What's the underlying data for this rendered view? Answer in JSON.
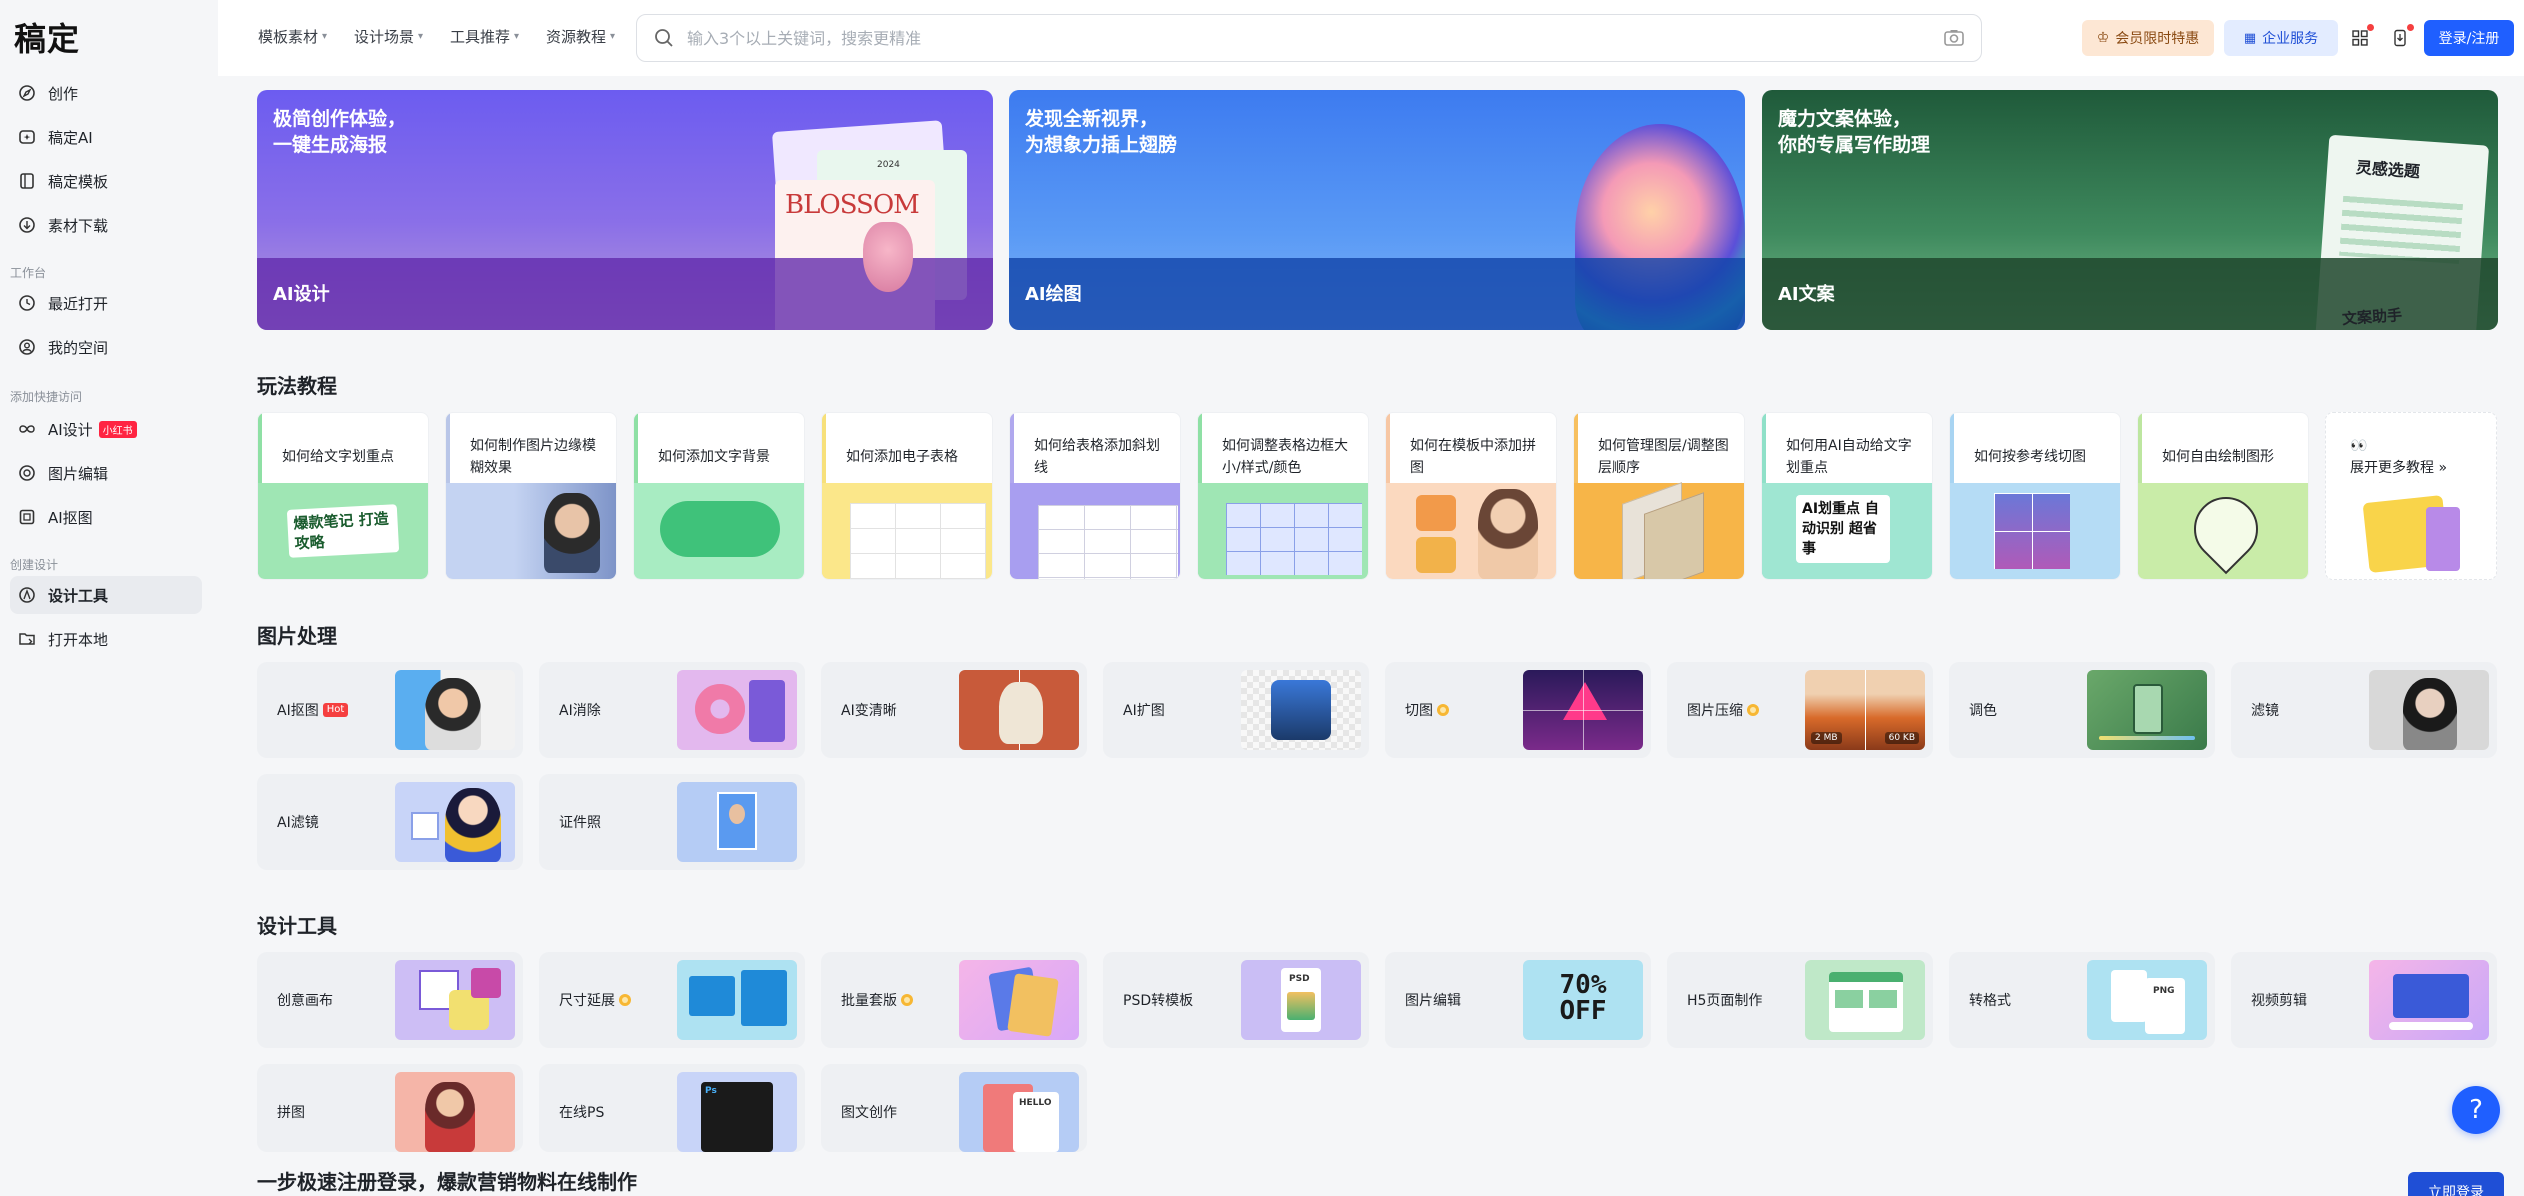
{
  "app": {
    "logo": "稿定"
  },
  "sidebar": {
    "items_top": [
      {
        "label": "创作",
        "icon": "compass-icon"
      },
      {
        "label": "稿定AI",
        "icon": "ai-spark-icon"
      },
      {
        "label": "稿定模板",
        "icon": "template-icon"
      },
      {
        "label": "素材下载",
        "icon": "download-circle-icon"
      }
    ],
    "group_workspace": "工作台",
    "items_workspace": [
      {
        "label": "最近打开",
        "icon": "clock-icon"
      },
      {
        "label": "我的空间",
        "icon": "user-circle-icon"
      }
    ],
    "group_shortcuts": "添加快捷访问",
    "items_shortcuts": [
      {
        "label": "AI设计",
        "icon": "infinity-icon",
        "badge": "小红书"
      },
      {
        "label": "图片编辑",
        "icon": "image-edit-icon"
      },
      {
        "label": "AI抠图",
        "icon": "cutout-icon"
      }
    ],
    "group_create": "创建设计",
    "items_create": [
      {
        "label": "设计工具",
        "icon": "design-tool-icon",
        "active": true
      },
      {
        "label": "打开本地",
        "icon": "open-folder-icon"
      }
    ]
  },
  "header": {
    "menus": [
      "模板素材",
      "设计场景",
      "工具推荐",
      "资源教程"
    ],
    "search_placeholder": "输入3个以上关键词，搜索更精准",
    "vip_label": "会员限时特惠",
    "enterprise_label": "企业服务",
    "login_label": "登录/注册"
  },
  "banners": [
    {
      "title": "极简创作体验，\n一键生成海报",
      "label": "AI设计",
      "art_text": "BLOSSOM",
      "art_year": "2024"
    },
    {
      "title": "发现全新视界，\n为想象力插上翅膀",
      "label": "AI绘图"
    },
    {
      "title": "魔力文案体验，\n你的专属写作助理",
      "label": "AI文案",
      "art_tag1": "灵感选题",
      "art_tag2": "文案助手"
    }
  ],
  "tutorials": {
    "title": "玩法教程",
    "items": [
      {
        "label": "如何给文字划重点",
        "thumb_text": "爆款笔记 打造攻略"
      },
      {
        "label": "如何制作图片边缘模糊效果"
      },
      {
        "label": "如何添加文字背景"
      },
      {
        "label": "如何添加电子表格"
      },
      {
        "label": "如何给表格添加斜划线"
      },
      {
        "label": "如何调整表格边框大小/样式/颜色"
      },
      {
        "label": "如何在模板中添加拼图"
      },
      {
        "label": "如何管理图层/调整图层顺序"
      },
      {
        "label": "如何用AI自动给文字划重点",
        "thumb_text": "AI划重点 自动识别 超省事"
      },
      {
        "label": "如何按参考线切图"
      },
      {
        "label": "如何自由绘制图形"
      },
      {
        "label": "展开更多教程",
        "emoji": "👀"
      }
    ]
  },
  "image_tools": {
    "title": "图片处理",
    "items": [
      {
        "label": "AI抠图",
        "tag": "Hot"
      },
      {
        "label": "AI消除"
      },
      {
        "label": "AI变清晰"
      },
      {
        "label": "AI扩图"
      },
      {
        "label": "切图",
        "vip": true
      },
      {
        "label": "图片压缩",
        "vip": true,
        "size_before": "2 MB",
        "size_after": "60 KB"
      },
      {
        "label": "调色"
      },
      {
        "label": "滤镜"
      },
      {
        "label": "AI滤镜"
      },
      {
        "label": "证件照"
      }
    ]
  },
  "design_tools": {
    "title": "设计工具",
    "items": [
      {
        "label": "创意画布"
      },
      {
        "label": "尺寸延展",
        "vip": true
      },
      {
        "label": "批量套版",
        "vip": true
      },
      {
        "label": "PSD转模板",
        "thumb_text": "PSD"
      },
      {
        "label": "图片编辑",
        "thumb_text": "70% OFF"
      },
      {
        "label": "H5页面制作"
      },
      {
        "label": "转格式",
        "thumb_text": "PNG"
      },
      {
        "label": "视频剪辑"
      },
      {
        "label": "拼图"
      },
      {
        "label": "在线PS",
        "thumb_text": "Ps"
      },
      {
        "label": "图文创作",
        "thumb_text": "HELLO"
      }
    ]
  },
  "footer": {
    "title": "一步极速注册登录，爆款营销物料在线制作",
    "button": "立即登录"
  },
  "help": {
    "label": "?"
  },
  "colors": {
    "primary": "#1f5fff",
    "hot": "#f53f3f",
    "vip": "#f7b733"
  }
}
